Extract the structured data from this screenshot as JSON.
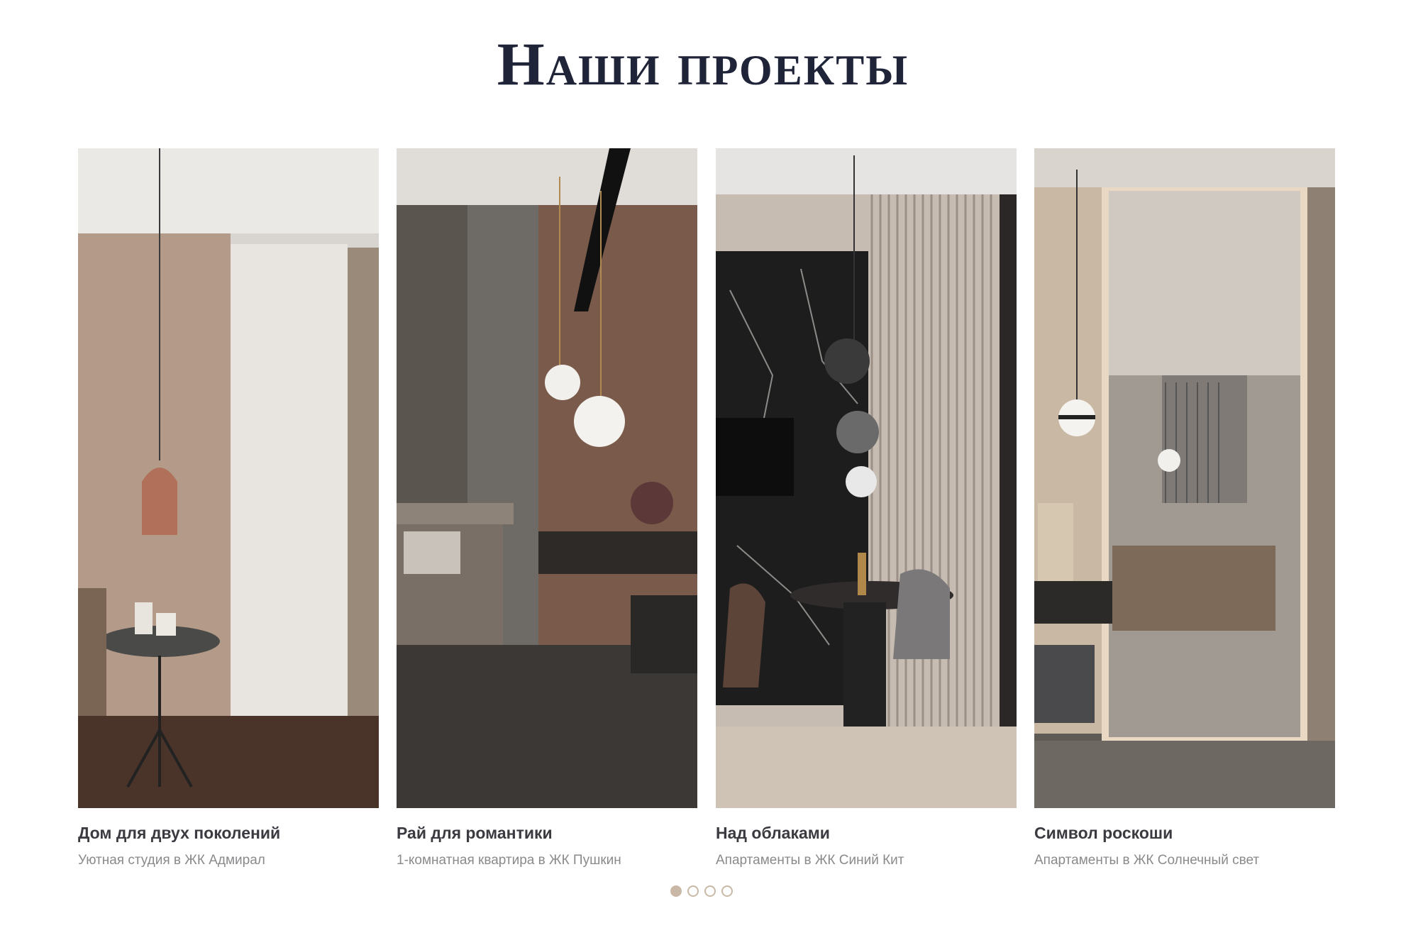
{
  "section": {
    "title": "Наши проекты"
  },
  "projects": [
    {
      "name": "Дом для двух поколений",
      "description": "Уютная студия в ЖК Адмирал"
    },
    {
      "name": "Рай для романтики",
      "description": "1-комнатная квартира в ЖК Пушкин"
    },
    {
      "name": "Над облаками",
      "description": "Апартаменты в ЖК Синий Кит"
    },
    {
      "name": "Символ роскоши",
      "description": "Апартаменты в ЖК Солнечный свет"
    }
  ],
  "pagination": {
    "pages": 4,
    "active": 1
  },
  "colors": {
    "title": "#1f2438",
    "accent": "#c9b8a6",
    "text": "#3a3a40",
    "muted": "#8a8a8c"
  }
}
